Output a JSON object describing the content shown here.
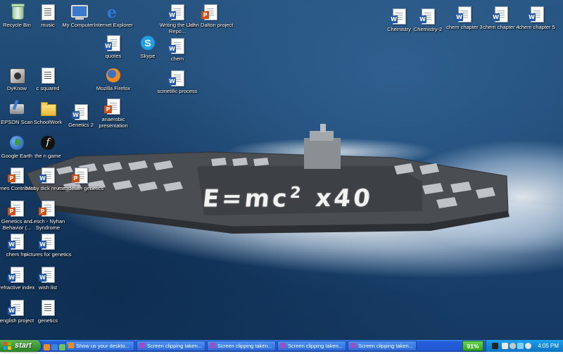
{
  "desktop": {
    "wallpaper_text": "E=mc",
    "wallpaper_sup": "2",
    "wallpaper_tail": "x40",
    "icons": [
      {
        "label": "Recycle Bin"
      },
      {
        "label": "music"
      },
      {
        "label": "My Computer"
      },
      {
        "label": "Internet Explorer"
      },
      {
        "label": "Writing the Lab Repo..."
      },
      {
        "label": "John Dalton project"
      },
      {
        "label": "quotes"
      },
      {
        "label": "Skype"
      },
      {
        "label": "chem"
      },
      {
        "label": "DyKnow"
      },
      {
        "label": "c squared"
      },
      {
        "label": "Mozilla Firefox"
      },
      {
        "label": "scinetific process"
      },
      {
        "label": "EPSON Scan"
      },
      {
        "label": "SchoolWork"
      },
      {
        "label": "Genetics 2"
      },
      {
        "label": "anaerobic presentation"
      },
      {
        "label": "Google Earth"
      },
      {
        "label": "the n game"
      },
      {
        "label": "Genes Contribute..."
      },
      {
        "label": "Moby dick revision"
      },
      {
        "label": "mendelian genetics"
      },
      {
        "label": "Genetics and Behavior (..."
      },
      {
        "label": "Lesch - Nyhan Syndrome"
      },
      {
        "label": "chem hw"
      },
      {
        "label": "pictures for genetics"
      },
      {
        "label": "refractive index"
      },
      {
        "label": "wish list"
      },
      {
        "label": "english project"
      },
      {
        "label": "genetics"
      },
      {
        "label": "Chemistry"
      },
      {
        "label": "Chemistry-2"
      },
      {
        "label": "chem chapter 3"
      },
      {
        "label": "chem chapter 4"
      },
      {
        "label": "chem chapter 5"
      }
    ]
  },
  "taskbar": {
    "start_label": "start",
    "buttons": [
      {
        "label": "Show us your deskto..."
      },
      {
        "label": "Screen clipping taken..."
      },
      {
        "label": "Screen clipping taken..."
      },
      {
        "label": "Screen clipping taken..."
      },
      {
        "label": "Screen clipping taken..."
      }
    ],
    "battery": "91%",
    "clock": "4:05 PM"
  },
  "colors": {
    "taskbar_blue": "#245edb",
    "start_green": "#3c9a37",
    "tray_blue": "#1488d8"
  }
}
